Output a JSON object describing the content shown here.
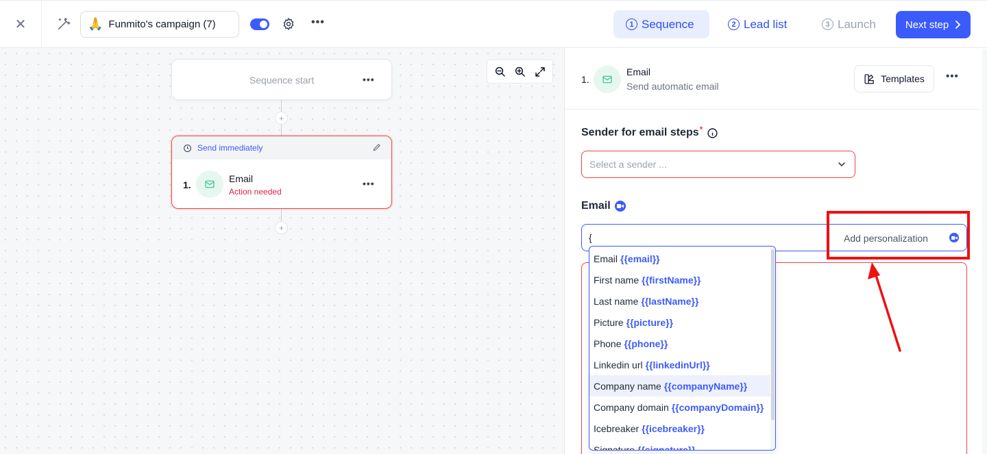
{
  "topbar": {
    "campaign_emoji": "🙏",
    "campaign_name": "Funmito's campaign (7)",
    "tabs": [
      {
        "num": "1",
        "label": "Sequence"
      },
      {
        "num": "2",
        "label": "Lead list"
      },
      {
        "num": "3",
        "label": "Launch"
      }
    ],
    "next_label": "Next step"
  },
  "canvas": {
    "start_label": "Sequence start",
    "step": {
      "timing": "Send immediately",
      "number": "1.",
      "title": "Email",
      "status": "Action needed"
    },
    "plus_symbol": "+"
  },
  "panel": {
    "step_number": "1.",
    "step_title": "Email",
    "step_subtitle": "Send automatic email",
    "templates_label": "Templates",
    "sender_label": "Sender for email steps",
    "sender_required": "*",
    "sender_placeholder": "Select a sender ...",
    "email_label": "Email",
    "subject_value": "{",
    "add_personalization": "Add personalization"
  },
  "personalization_options": [
    {
      "label": "Email",
      "token": "{{email}}"
    },
    {
      "label": "First name",
      "token": "{{firstName}}"
    },
    {
      "label": "Last name",
      "token": "{{lastName}}"
    },
    {
      "label": "Picture",
      "token": "{{picture}}"
    },
    {
      "label": "Phone",
      "token": "{{phone}}"
    },
    {
      "label": "Linkedin url",
      "token": "{{linkedinUrl}}"
    },
    {
      "label": "Company name",
      "token": "{{companyName}}"
    },
    {
      "label": "Company domain",
      "token": "{{companyDomain}}"
    },
    {
      "label": "Icebreaker",
      "token": "{{icebreaker}}"
    },
    {
      "label": "Signature",
      "token": "{{signature}}"
    }
  ],
  "colors": {
    "accent": "#3b5bfd",
    "error": "#ef4444",
    "annotation": "#ee1111",
    "email_icon_bg": "#e6f7ef"
  }
}
